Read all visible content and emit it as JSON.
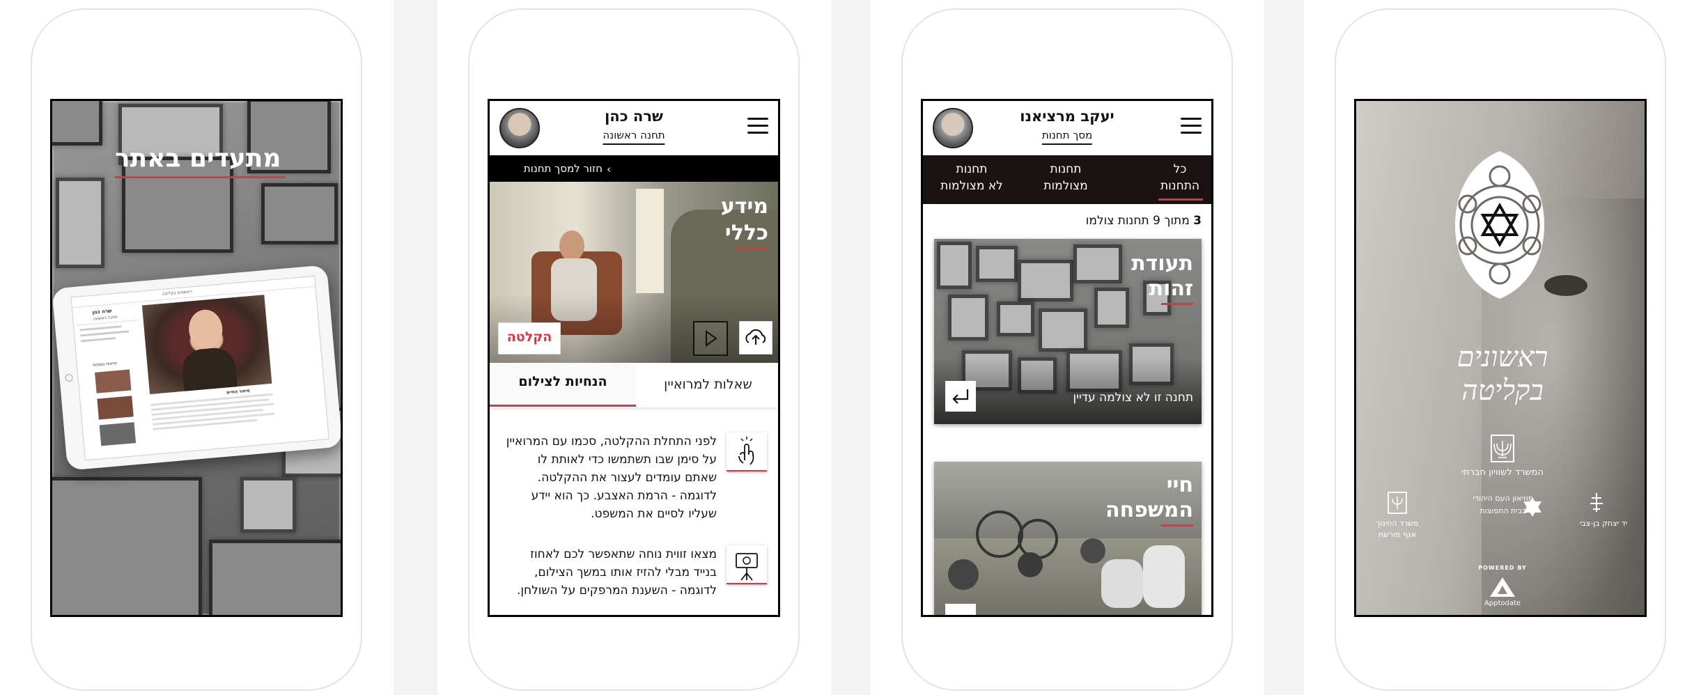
{
  "screen1": {
    "title": "מתעדים באתר",
    "tablet": {
      "logo": "ראשונים בקליטה",
      "person_name": "שרה כהן",
      "person_sub": "תחנה ראשונה",
      "section_label": "תחנות נוספות",
      "story_title": "סיפור החיים"
    }
  },
  "screen2": {
    "header": {
      "name": "שרה כהן",
      "subtitle": "תחנה ראשונה"
    },
    "back_label": "חזור למסך תחנות",
    "station_title_line1": "מידע",
    "station_title_line2": "כללי",
    "record_label": "הקלטה",
    "tabs": [
      {
        "label": "שאלות למרואיין",
        "active": false
      },
      {
        "label": "הנחיות לצילום",
        "active": true
      }
    ],
    "tips": [
      {
        "icon": "hand-tap-icon",
        "lines": [
          "לפני התחלת ההקלטה, סכמו עם המרואיין",
          "על סימן שבו תשתמשו כדי לאותת לו",
          "שאתם עומדים לעצור את ההקלטה.",
          "לדוגמה - הרמת האצבע. כך הוא יידע",
          "שעליו לסיים את המשפט."
        ]
      },
      {
        "icon": "tablet-tripod-icon",
        "lines": [
          "מצאו זווית נוחה שתאפשר לכם לאחוז",
          "בנייד מבלי להזיז אותו במשך הצילום,",
          "לדוגמה - השענת המרפקים על השולחן."
        ]
      }
    ]
  },
  "screen3": {
    "header": {
      "name": "יעקב מרציאנו",
      "subtitle": "מסך תחנות"
    },
    "filters": [
      {
        "line1": "כל",
        "line2": "התחנות",
        "active": true
      },
      {
        "line1": "תחנות",
        "line2": "מצולמות",
        "active": false
      },
      {
        "line1": "תחנות",
        "line2": "לא מצולמות",
        "active": false
      }
    ],
    "count_number": "3",
    "count_text": "מתוך 9 תחנות צולמו",
    "cards": [
      {
        "title_line1": "תעודת",
        "title_line2": "זהות",
        "status": "תחנה זו לא צולמה עדיין"
      },
      {
        "title_line1": "חיי",
        "title_line2": "המשפחה",
        "status": ""
      }
    ]
  },
  "screen4": {
    "app_title_line1": "ראשונים",
    "app_title_line2": "בקליטה",
    "ministry_main": "המשרד לשוויון חברתי",
    "partners": [
      {
        "line1": "משרד החינוך",
        "line2": "אגף מורשת"
      },
      {
        "line1": "מוזיאון העם היהודי",
        "line2": "בבית התפוצות"
      },
      {
        "line1": "יד יצחק בן-צבי",
        "line2": ""
      }
    ],
    "powered_by": "POWERED BY",
    "brand": "Apptodate"
  },
  "colors": {
    "accent": "#e5323d",
    "dark_bar": "#1a1212",
    "text": "#111111"
  }
}
